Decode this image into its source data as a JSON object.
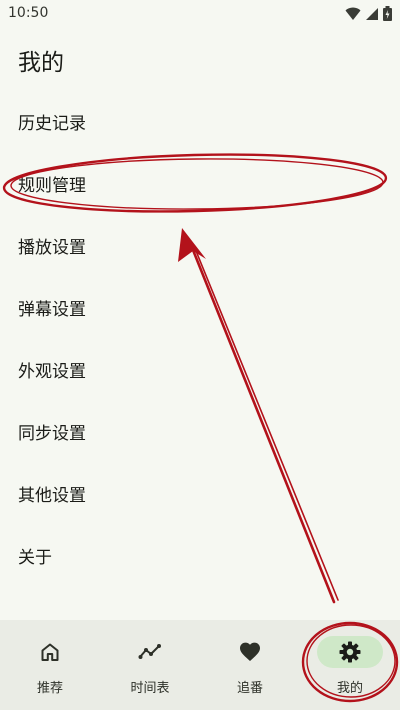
{
  "status_bar": {
    "time": "10:50",
    "icons": [
      "wifi-icon",
      "signal-icon",
      "battery-icon"
    ]
  },
  "page": {
    "title": "我的"
  },
  "menu": {
    "items": [
      {
        "label": "历史记录"
      },
      {
        "label": "规则管理"
      },
      {
        "label": "播放设置"
      },
      {
        "label": "弹幕设置"
      },
      {
        "label": "外观设置"
      },
      {
        "label": "同步设置"
      },
      {
        "label": "其他设置"
      },
      {
        "label": "关于"
      }
    ]
  },
  "bottom_nav": {
    "items": [
      {
        "label": "推荐",
        "icon": "home-icon"
      },
      {
        "label": "时间表",
        "icon": "timeline-icon"
      },
      {
        "label": "追番",
        "icon": "heart-icon"
      },
      {
        "label": "我的",
        "icon": "gear-icon",
        "active": true
      }
    ]
  },
  "colors": {
    "background": "#f6f8f2",
    "nav_background": "#eaece5",
    "active_pill": "#cfe8c8",
    "annotation": "#b3121b"
  }
}
